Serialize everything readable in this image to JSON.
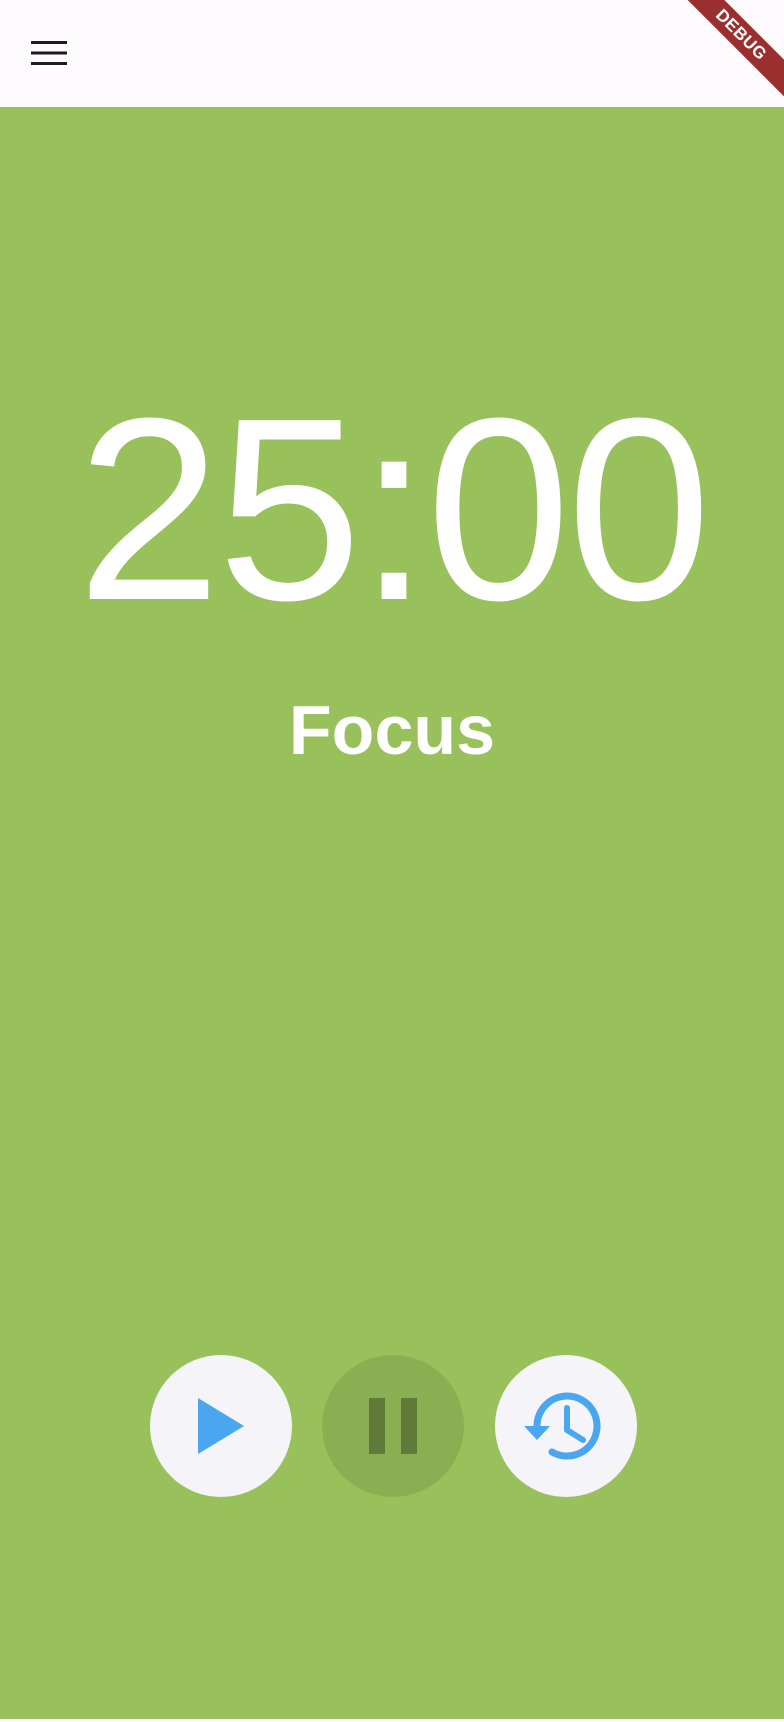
{
  "app_bar": {
    "menu_icon": "hamburger-menu-icon"
  },
  "debug_banner": {
    "label": "DEBUG",
    "color": "#9b2f2f"
  },
  "timer": {
    "time": "25:00",
    "phase": "Focus",
    "background_color": "#98c15c"
  },
  "controls": {
    "play": {
      "icon": "play-icon",
      "enabled": true,
      "icon_color": "#4aa6ee"
    },
    "pause": {
      "icon": "pause-icon",
      "enabled": false,
      "icon_color": "#5f7a39"
    },
    "reset": {
      "icon": "restore-history-icon",
      "enabled": true,
      "icon_color": "#4aa6ee"
    }
  }
}
